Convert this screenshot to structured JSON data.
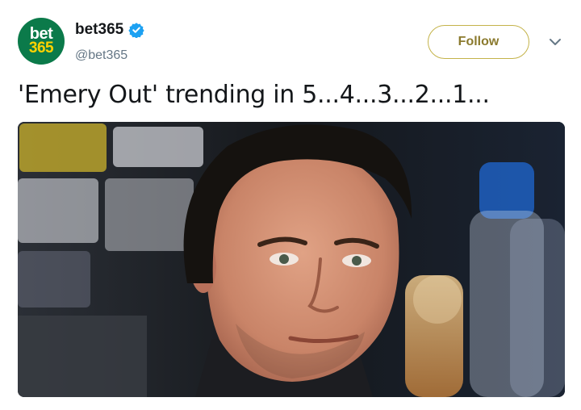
{
  "account": {
    "avatar_line1": "bet",
    "avatar_line2": "365",
    "display_name": "bet365",
    "handle": "@bet365",
    "verified": true,
    "avatar_icon": "bet365-logo-icon",
    "verified_icon": "verified-badge-icon"
  },
  "actions": {
    "follow_label": "Follow",
    "menu_icon": "chevron-down-icon"
  },
  "tweet": {
    "text": "'Emery Out' trending in 5...4...3...2...1..."
  },
  "colors": {
    "avatar_bg": "#0b7a4a",
    "avatar_accent": "#ffd200",
    "verified_blue": "#1da1f2",
    "follow_border": "#c4b34a",
    "follow_text": "#8b7a2e"
  }
}
